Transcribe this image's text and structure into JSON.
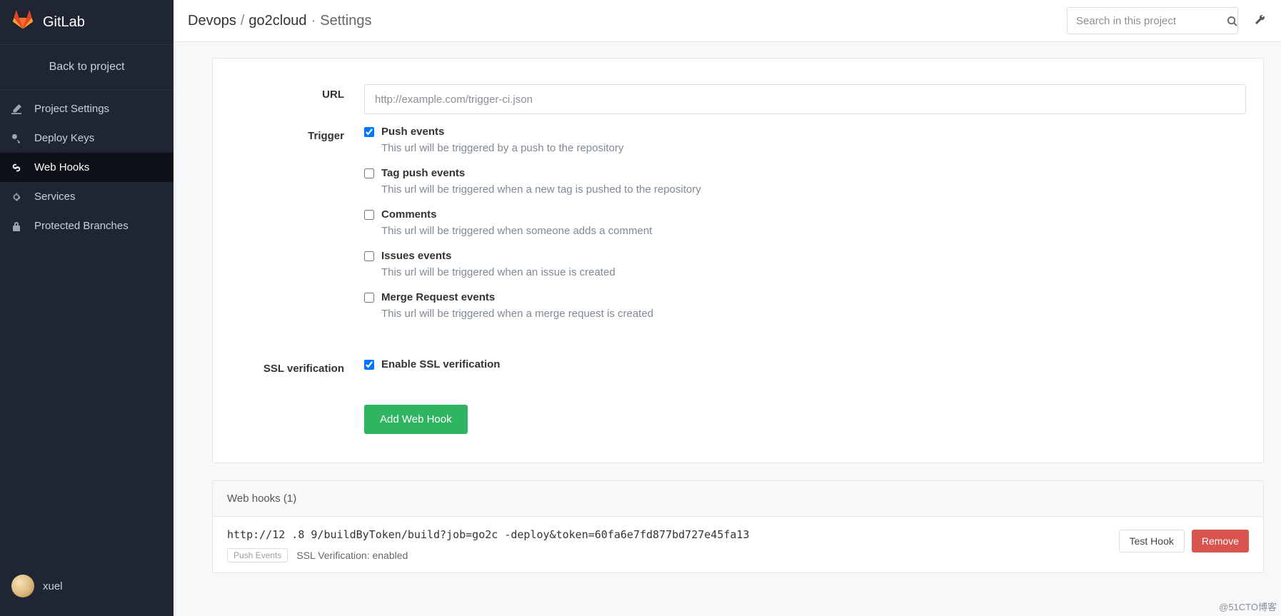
{
  "brand": "GitLab",
  "back_link": "Back to project",
  "nav": [
    {
      "id": "project-settings",
      "label": "Project Settings",
      "active": false
    },
    {
      "id": "deploy-keys",
      "label": "Deploy Keys",
      "active": false
    },
    {
      "id": "web-hooks",
      "label": "Web Hooks",
      "active": true
    },
    {
      "id": "services",
      "label": "Services",
      "active": false
    },
    {
      "id": "protected-branches",
      "label": "Protected Branches",
      "active": false
    }
  ],
  "user": {
    "name": "xuel"
  },
  "breadcrumb": {
    "group": "Devops",
    "project": "go2cloud",
    "page": "Settings"
  },
  "search": {
    "placeholder": "Search in this project"
  },
  "form": {
    "url_label": "URL",
    "url_placeholder": "http://example.com/trigger-ci.json",
    "trigger_label": "Trigger",
    "triggers": [
      {
        "id": "push",
        "title": "Push events",
        "desc": "This url will be triggered by a push to the repository",
        "checked": true
      },
      {
        "id": "tag",
        "title": "Tag push events",
        "desc": "This url will be triggered when a new tag is pushed to the repository",
        "checked": false
      },
      {
        "id": "comment",
        "title": "Comments",
        "desc": "This url will be triggered when someone adds a comment",
        "checked": false
      },
      {
        "id": "issue",
        "title": "Issues events",
        "desc": "This url will be triggered when an issue is created",
        "checked": false
      },
      {
        "id": "merge",
        "title": "Merge Request events",
        "desc": "This url will be triggered when a merge request is created",
        "checked": false
      }
    ],
    "ssl_label": "SSL verification",
    "ssl_checkbox_label": "Enable SSL verification",
    "ssl_checked": true,
    "submit_label": "Add Web Hook"
  },
  "hooks": {
    "header": "Web hooks (1)",
    "items": [
      {
        "url": "http://12          .8  9/buildByToken/build?job=go2c                    -deploy&token=60fa6e7fd877bd727e45fa13",
        "badge": "Push Events",
        "ssl_text": "SSL Verification: enabled",
        "test_label": "Test Hook",
        "remove_label": "Remove"
      }
    ]
  },
  "watermark": "@51CTO博客"
}
